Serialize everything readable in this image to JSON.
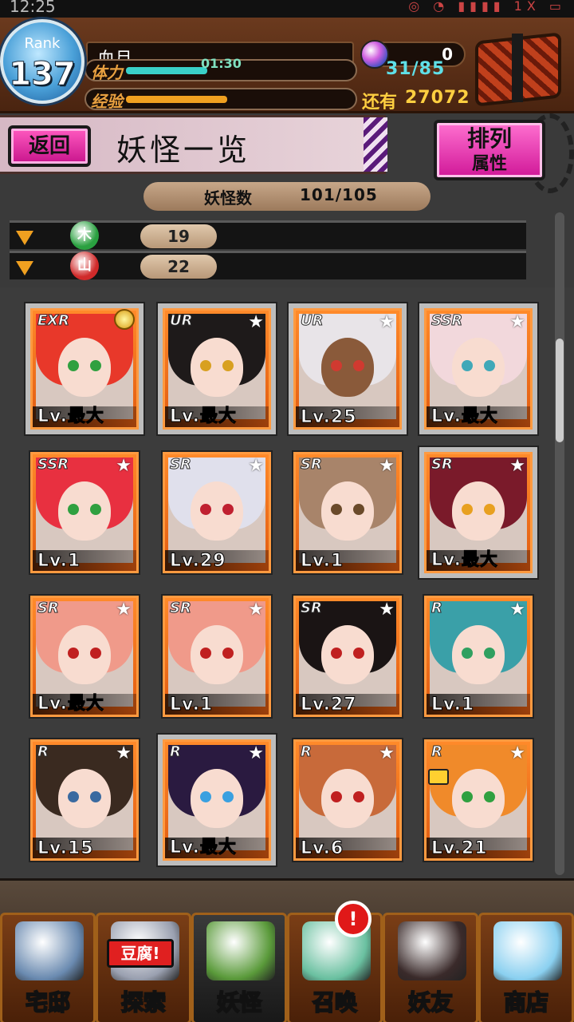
{
  "status": {
    "time": "12:25",
    "indicators": "◎ ◔ ▮▮▮▮ 1X ▭"
  },
  "player": {
    "rank_label": "Rank",
    "rank_value": "137",
    "name": "血月",
    "stamina_label": "体力",
    "stamina_timer": "01:30",
    "stamina_value": "31/85",
    "stamina_fraction": 0.36,
    "exp_label": "经验",
    "exp_fraction": 0.45,
    "exp_remaining_label": "还有",
    "exp_remaining_value": "27072",
    "gems": "0"
  },
  "titlebar": {
    "back_label": "返回",
    "title": "妖怪一览",
    "sort_line1": "排列",
    "sort_line2": "属性"
  },
  "monster_count": {
    "label": "妖怪数",
    "value": "101/105"
  },
  "attributes": [
    {
      "symbol": "木",
      "count": "19",
      "color": "#2aa040"
    },
    {
      "symbol": "山",
      "count": "22",
      "color": "#d02a2a"
    }
  ],
  "cards": [
    {
      "rarity": "EXR",
      "level": "Lv.最大",
      "selected": true,
      "hair": "#e8382a",
      "eye": "#30a040",
      "medal": true
    },
    {
      "rarity": "UR",
      "level": "Lv.最大",
      "selected": true,
      "hair": "#1e1a1a",
      "eye": "#d8a020"
    },
    {
      "rarity": "UR",
      "level": "Lv.25",
      "selected": true,
      "hair": "#e8e4e8",
      "eye": "#d03a30",
      "skin": "#8a5a3a"
    },
    {
      "rarity": "SSR",
      "level": "Lv.最大",
      "selected": true,
      "hair": "#f2d8dc",
      "eye": "#40a8b8"
    },
    {
      "rarity": "SSR",
      "level": "Lv.1",
      "selected": false,
      "hair": "#e83040",
      "eye": "#30a040"
    },
    {
      "rarity": "SR",
      "level": "Lv.29",
      "selected": false,
      "hair": "#e0e0ec",
      "eye": "#c02030"
    },
    {
      "rarity": "SR",
      "level": "Lv.1",
      "selected": false,
      "hair": "#a8846a",
      "eye": "#6a4a2a"
    },
    {
      "rarity": "SR",
      "level": "Lv.最大",
      "selected": true,
      "hair": "#7a1a2a",
      "eye": "#e8a020"
    },
    {
      "rarity": "SR",
      "level": "Lv.最大",
      "selected": false,
      "hair": "#f09a8a",
      "eye": "#c02020"
    },
    {
      "rarity": "SR",
      "level": "Lv.1",
      "selected": false,
      "hair": "#f09a8a",
      "eye": "#c02020"
    },
    {
      "rarity": "SR",
      "level": "Lv.27",
      "selected": false,
      "hair": "#1a1414",
      "eye": "#c02020"
    },
    {
      "rarity": "R",
      "level": "Lv.1",
      "selected": false,
      "hair": "#3aa0a8",
      "eye": "#30a060"
    },
    {
      "rarity": "R",
      "level": "Lv.15",
      "selected": false,
      "hair": "#3a2a20",
      "eye": "#3a6aa0"
    },
    {
      "rarity": "R",
      "level": "Lv.最大",
      "selected": true,
      "hair": "#2a1a40",
      "eye": "#3aa0e0"
    },
    {
      "rarity": "R",
      "level": "Lv.6",
      "selected": false,
      "hair": "#c86a3a",
      "eye": "#c02020"
    },
    {
      "rarity": "R",
      "level": "Lv.21",
      "selected": false,
      "hair": "#f08a2a",
      "eye": "#30a040",
      "bag": true
    }
  ],
  "nav": [
    {
      "label": "宅邸",
      "icon": "house-icon",
      "color": "#6a8ab0"
    },
    {
      "label": "探索",
      "icon": "explore-icon",
      "color": "#9aa0b0",
      "tag": "豆腐!"
    },
    {
      "label": "妖怪",
      "icon": "scroll-icon",
      "color": "#5a9a3a",
      "active": true
    },
    {
      "label": "召唤",
      "icon": "pentagram-icon",
      "color": "#6ac0a0",
      "badge": "!"
    },
    {
      "label": "妖友",
      "icon": "friend-icon",
      "color": "#3a2a2a"
    },
    {
      "label": "商店",
      "icon": "orb-icon",
      "color": "#8ad0f0"
    }
  ]
}
